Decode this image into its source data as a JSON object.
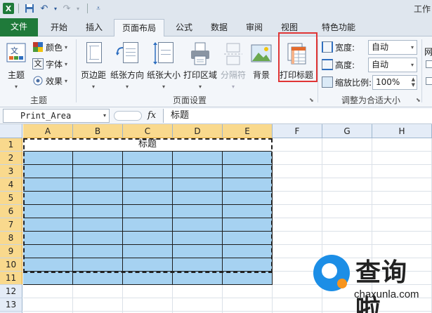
{
  "window": {
    "title_fragment": "工作"
  },
  "tabs": [
    {
      "label": "文件",
      "id": "file"
    },
    {
      "label": "开始",
      "id": "home"
    },
    {
      "label": "插入",
      "id": "insert"
    },
    {
      "label": "页面布局",
      "id": "pagelayout"
    },
    {
      "label": "公式",
      "id": "formulas"
    },
    {
      "label": "数据",
      "id": "data"
    },
    {
      "label": "审阅",
      "id": "review"
    },
    {
      "label": "视图",
      "id": "view"
    },
    {
      "label": "特色功能",
      "id": "features"
    }
  ],
  "ribbon": {
    "theme_group": {
      "label": "主题",
      "main_button": "主题",
      "colors": "颜色",
      "fonts": "字体",
      "effects": "效果"
    },
    "page_setup_group": {
      "label": "页面设置",
      "margins": "页边距",
      "orientation": "纸张方向",
      "size": "纸张大小",
      "print_area": "打印区域",
      "breaks": "分隔符",
      "background": "背景",
      "print_titles": "打印标题"
    },
    "scale_group": {
      "label": "调整为合适大小",
      "width_label": "宽度:",
      "width_value": "自动",
      "height_label": "高度:",
      "height_value": "自动",
      "scale_label": "缩放比例:",
      "scale_value": "100%"
    },
    "sheet_options_fragment": "网"
  },
  "formula_bar": {
    "name_box": "Print_Area",
    "fx": "fx",
    "content": "标题"
  },
  "sheet": {
    "columns": [
      "A",
      "B",
      "C",
      "D",
      "E",
      "F",
      "G",
      "H"
    ],
    "rows": [
      "1",
      "2",
      "3",
      "4",
      "5",
      "6",
      "7",
      "8",
      "9",
      "10",
      "11",
      "12",
      "13",
      "14"
    ],
    "title_cell": "标题"
  },
  "watermark": {
    "text": "查询啦",
    "sub": "chaxunla.com"
  }
}
